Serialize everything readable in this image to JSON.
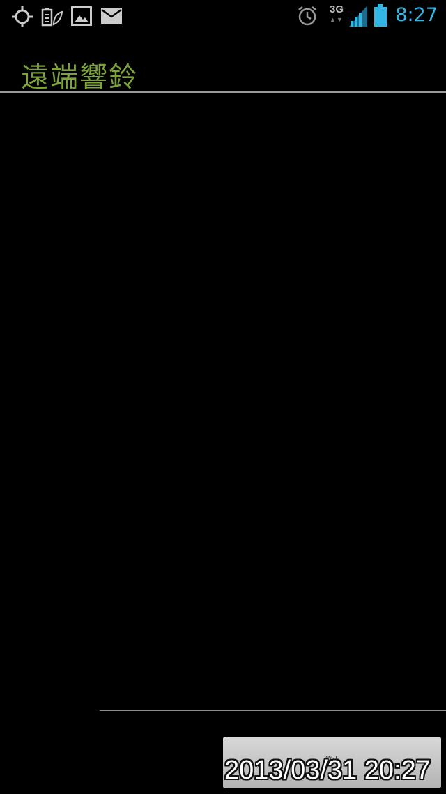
{
  "status_bar": {
    "time": "8:27",
    "network": "3G",
    "network_arrows": "▲▼",
    "icons": [
      "gps-icon",
      "battery-saver-icon",
      "image-icon",
      "mail-icon",
      "alarm-icon",
      "signal-icon",
      "battery-icon"
    ],
    "clock_color": "#33b5e5"
  },
  "app": {
    "title": "遠端響鈴",
    "title_color": "#7ea33c"
  },
  "bottom": {
    "stop_label": "停止",
    "datetime": "2013/03/31 20:27"
  }
}
